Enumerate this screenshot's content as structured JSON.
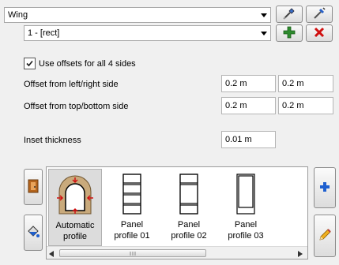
{
  "element_combo": {
    "value": "Wing",
    "arrow_icon": "dropdown-arrow-icon"
  },
  "profile_combo": {
    "value": "1 - [rect]",
    "arrow_icon": "dropdown-arrow-icon"
  },
  "toolbar": {
    "pick_icon": "eyedropper-icon",
    "inject_icon": "syringe-icon",
    "add_icon": "plus-icon",
    "delete_icon": "close-icon",
    "add_color": "#2e8b2e",
    "delete_color": "#d01010"
  },
  "offsets": {
    "use_all_label": "Use offsets for all 4 sides",
    "use_all_checked": true,
    "left_right_label": "Offset from left/right side",
    "left_value": "0.2 m",
    "right_value": "0.2 m",
    "top_bottom_label": "Offset from top/bottom side",
    "top_value": "0.2 m",
    "bottom_value": "0.2 m"
  },
  "inset": {
    "label": "Inset thickness",
    "value": "0.01 m"
  },
  "gallery": {
    "items": [
      {
        "caption_line1": "Automatic",
        "caption_line2": "profile",
        "selected": true
      },
      {
        "caption_line1": "Panel",
        "caption_line2": "profile 01",
        "selected": false
      },
      {
        "caption_line1": "Panel",
        "caption_line2": "profile 02",
        "selected": false
      },
      {
        "caption_line1": "Panel",
        "caption_line2": "profile 03",
        "selected": false
      }
    ]
  },
  "side_buttons": {
    "door_icon": "door-icon",
    "paint_icon": "paint-bucket-icon",
    "add_icon": "blue-plus-icon",
    "edit_icon": "pencil-icon"
  },
  "colors": {
    "accent_blue": "#1e5fcf",
    "door_orange": "#b5651d"
  }
}
